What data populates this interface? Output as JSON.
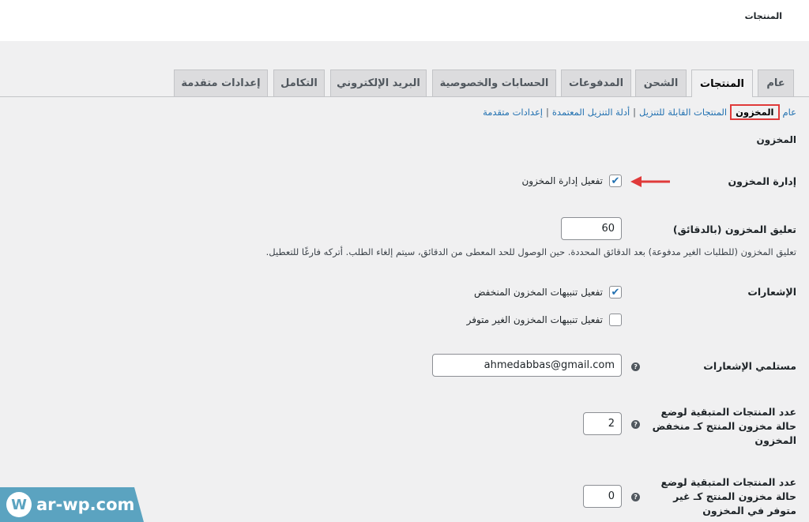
{
  "header": {
    "title": "المنتجات"
  },
  "tabs": [
    {
      "label": "عام"
    },
    {
      "label": "المنتجات"
    },
    {
      "label": "الشحن"
    },
    {
      "label": "المدفوعات"
    },
    {
      "label": "الحسابات والخصوصية"
    },
    {
      "label": "البريد الإلكتروني"
    },
    {
      "label": "التكامل"
    },
    {
      "label": "إعدادات متقدمة"
    }
  ],
  "subnav": [
    {
      "label": "عام"
    },
    {
      "label": "المخزون"
    },
    {
      "label": "المنتجات القابلة للتنزيل"
    },
    {
      "label": "أدلة التنزيل المعتمدة"
    },
    {
      "label": "إعدادات متقدمة"
    }
  ],
  "subnav_sep": "|",
  "section_title": "المخزون",
  "manage_stock": {
    "label": "إدارة المخزون",
    "option": "تفعيل إدارة المخزون",
    "checked": true
  },
  "hold_stock": {
    "label": "تعليق المخزون (بالدقائق)",
    "value": "60",
    "description": "تعليق المخزون (للطلبات الغير مدفوعة) بعد الدقائق المحددة. حين الوصول للحد المعطى من الدقائق، سيتم إلغاء الطلب. أتركه فارغًا للتعطيل."
  },
  "notifications": {
    "label": "الإشعارات",
    "options": [
      {
        "label": "تفعيل تنبيهات المخزون المنخفض",
        "checked": true
      },
      {
        "label": "تفعيل تنبيهات المخزون الغير متوفر",
        "checked": false
      }
    ]
  },
  "recipient": {
    "label": "مستلمي الإشعارات",
    "value": "ahmedabbas@gmail.com"
  },
  "low_threshold": {
    "label": "عدد المنتجات المتبقية لوضع حالة مخزون المنتج كـ منخفض المخزون",
    "value": "2"
  },
  "out_threshold": {
    "label": "عدد المنتجات المتبقية لوضع حالة مخزون المنتج كـ غير متوفر في المخزون",
    "value": "0"
  },
  "help_glyph": "?",
  "check_glyph": "✔",
  "watermark": {
    "logo": "W",
    "text": "ar-wp.com"
  },
  "colors": {
    "accent": "#2271b1",
    "highlight": "#e03a3a",
    "watermark": "#5ba3c0"
  }
}
